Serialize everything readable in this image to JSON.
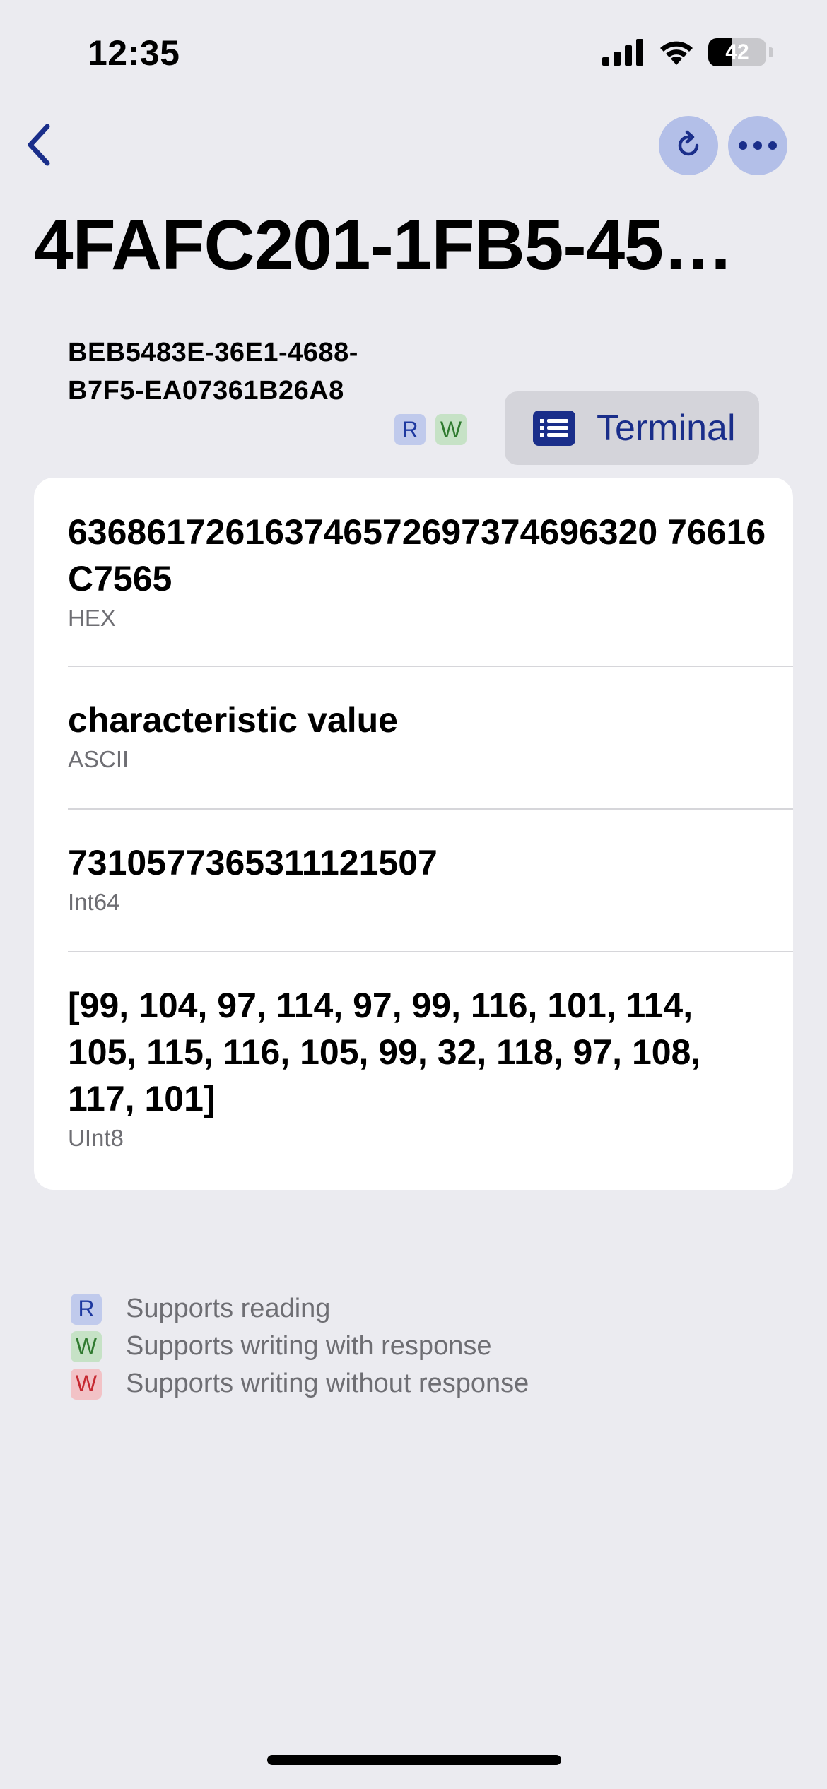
{
  "status_bar": {
    "time": "12:35",
    "battery_level": "42",
    "battery_fraction": 0.42
  },
  "nav": {
    "back_icon": "chevron-left-icon",
    "refresh_icon": "refresh-icon",
    "more_icon": "ellipsis-icon"
  },
  "page": {
    "title": "4FAFC201-1FB5-45…"
  },
  "characteristic": {
    "uuid": "BEB5483E-36E1-4688-B7F5-EA07361B26A8",
    "badges": [
      "R",
      "W"
    ],
    "terminal_label": "Terminal"
  },
  "values": [
    {
      "value": "636861726163746572697374696320 76616C7565",
      "format": "HEX"
    },
    {
      "value": "characteristic value",
      "format": "ASCII"
    },
    {
      "value": "7310577365311121507",
      "format": "Int64"
    },
    {
      "value": "[99, 104, 97, 114, 97, 99, 116, 101, 114, 105, 115, 116, 105, 99, 32, 118, 97, 108, 117, 101]",
      "format": "UInt8"
    }
  ],
  "legend": [
    {
      "badge": "R",
      "label": "Supports reading"
    },
    {
      "badge": "W",
      "label": "Supports writing with response"
    },
    {
      "badge": "W",
      "label": "Supports writing without response"
    }
  ],
  "colors": {
    "background": "#EBEBF0",
    "accent": "#1A2E8A",
    "button_bg": "#B3BFE8"
  }
}
